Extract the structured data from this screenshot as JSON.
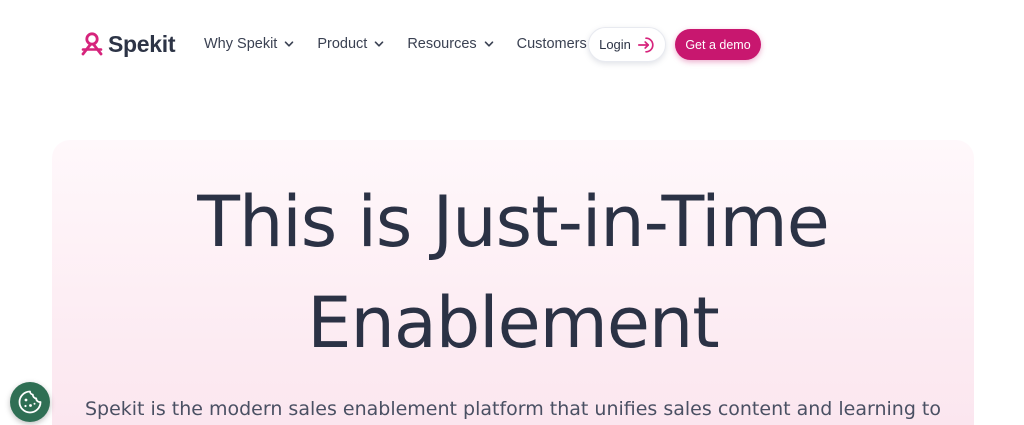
{
  "header": {
    "brand_name": "Spekit",
    "brand_icon": "spekit-logo-icon",
    "nav_items": [
      {
        "label": "Why Spekit",
        "has_dropdown": true
      },
      {
        "label": "Product",
        "has_dropdown": true
      },
      {
        "label": "Resources",
        "has_dropdown": true
      },
      {
        "label": "Customers",
        "has_dropdown": false
      }
    ],
    "login_label": "Login",
    "login_icon": "login-arrow-icon",
    "demo_label": "Get a demo"
  },
  "hero": {
    "title_line1": "This is Just-in-Time",
    "title_line2": "Enablement",
    "subtitle": "Spekit is the modern sales enablement platform that unifies sales content and learning to"
  },
  "cookie_button": {
    "icon": "cookie-icon"
  },
  "colors": {
    "brand_accent": "#c8176f",
    "text_dark": "#2b3245",
    "hero_background": "#fdeef4",
    "cookie_button": "#2f6f54"
  }
}
